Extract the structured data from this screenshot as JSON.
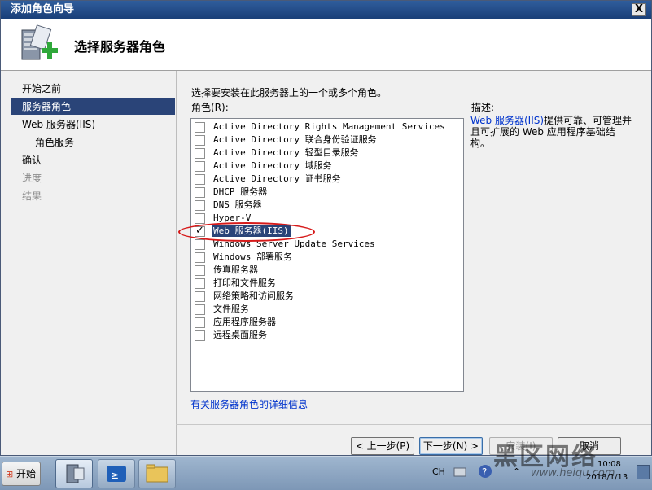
{
  "window": {
    "title": "添加角色向导",
    "close_glyph": "X",
    "header_title": "选择服务器角色"
  },
  "sidebar": {
    "items": [
      {
        "label": "开始之前",
        "state": "normal"
      },
      {
        "label": "服务器角色",
        "state": "active"
      },
      {
        "label": "Web 服务器(IIS)",
        "state": "normal"
      },
      {
        "label": "角色服务",
        "state": "sub"
      },
      {
        "label": "确认",
        "state": "normal"
      },
      {
        "label": "进度",
        "state": "disabled"
      },
      {
        "label": "结果",
        "state": "disabled"
      }
    ]
  },
  "content": {
    "instruction": "选择要安装在此服务器上的一个或多个角色。",
    "roles_label": "角色(R):",
    "roles": [
      {
        "label": "Active Directory Rights Management Services",
        "checked": false
      },
      {
        "label": "Active Directory 联合身份验证服务",
        "checked": false
      },
      {
        "label": "Active Directory 轻型目录服务",
        "checked": false
      },
      {
        "label": "Active Directory 域服务",
        "checked": false
      },
      {
        "label": "Active Directory 证书服务",
        "checked": false
      },
      {
        "label": "DHCP 服务器",
        "checked": false
      },
      {
        "label": "DNS 服务器",
        "checked": false
      },
      {
        "label": "Hyper-V",
        "checked": false
      },
      {
        "label": "Web 服务器(IIS)",
        "checked": true
      },
      {
        "label": "Windows Server Update Services",
        "checked": false
      },
      {
        "label": "Windows 部署服务",
        "checked": false
      },
      {
        "label": "传真服务器",
        "checked": false
      },
      {
        "label": "打印和文件服务",
        "checked": false
      },
      {
        "label": "网络策略和访问服务",
        "checked": false
      },
      {
        "label": "文件服务",
        "checked": false
      },
      {
        "label": "应用程序服务器",
        "checked": false
      },
      {
        "label": "远程桌面服务",
        "checked": false
      }
    ],
    "more_info_link": "有关服务器角色的详细信息",
    "description_title": "描述:",
    "description_link": "Web 服务器(IIS)",
    "description_text": "提供可靠、可管理并且可扩展的 Web 应用程序基础结构。"
  },
  "buttons": {
    "back": "< 上一步(P)",
    "next": "下一步(N) >",
    "install": "安装(I)",
    "cancel": "取消"
  },
  "taskbar": {
    "start": "开始",
    "lang": "CH",
    "time": "10:08",
    "date": "2018/1/13"
  },
  "watermark": {
    "text": "黑区网络",
    "url": "www.heiqu.com"
  },
  "colors": {
    "selection": "#2a4478",
    "link": "#0033cc",
    "annotation": "#d61a1a"
  }
}
